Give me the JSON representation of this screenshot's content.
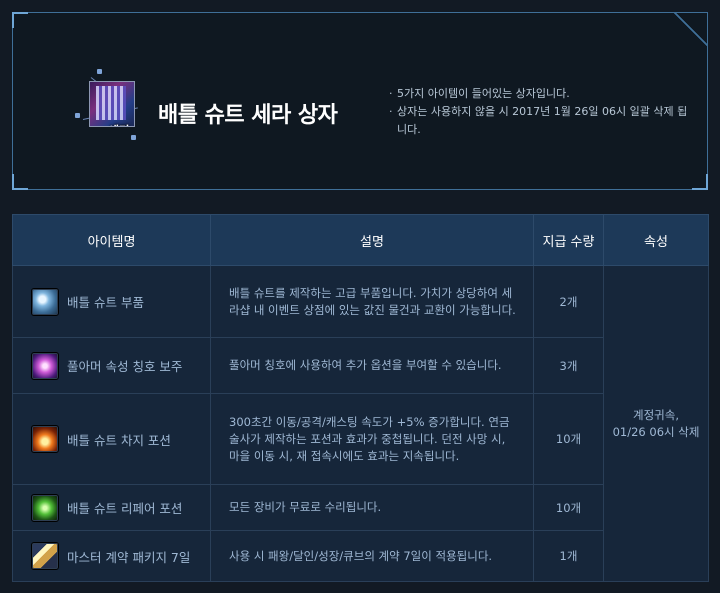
{
  "box": {
    "title": "배틀 슈트 세라 상자",
    "icon_tag": "세라",
    "notes": [
      "5가지 아이템이 들어있는 상자입니다.",
      "상자는 사용하지 않을 시 2017년 1월 26일 06시 일괄 삭제 됩니다."
    ]
  },
  "table": {
    "headers": {
      "name": "아이템명",
      "desc": "설명",
      "qty": "지급 수량",
      "attr": "속성"
    },
    "attr_value": "계정귀속,\n01/26 06시 삭제",
    "rows": [
      {
        "icon": "battle-suit-parts-icon",
        "name": "배틀 슈트 부품",
        "desc": "배틀 슈트를 제작하는 고급 부품입니다. 가치가 상당하여 세라샵 내 이벤트 상점에 있는 값진 물건과 교환이 가능합니다.",
        "qty": "2개"
      },
      {
        "icon": "full-armor-title-orb-icon",
        "name": "풀아머 속성 칭호 보주",
        "desc": "풀아머 칭호에 사용하여 추가 옵션을 부여할 수 있습니다.",
        "qty": "3개"
      },
      {
        "icon": "speed-potion-icon",
        "name": "배틀 슈트 차지 포션",
        "desc": "300초간 이동/공격/캐스팅 속도가 +5% 증가합니다. 연금술사가 제작하는 포션과 효과가 중첩됩니다. 던전 사망 시, 마을 이동 시, 재 접속시에도 효과는 지속됩니다.",
        "qty": "10개"
      },
      {
        "icon": "repair-potion-icon",
        "name": "배틀 슈트 리페어 포션",
        "desc": "모든 장비가 무료로 수리됩니다.",
        "qty": "10개"
      },
      {
        "icon": "master-contract-icon",
        "name": "마스터 계약 패키지 7일",
        "desc": "사용 시 패왕/달인/성장/큐브의 계약 7일이 적용됩니다.",
        "qty": "1개"
      }
    ]
  }
}
